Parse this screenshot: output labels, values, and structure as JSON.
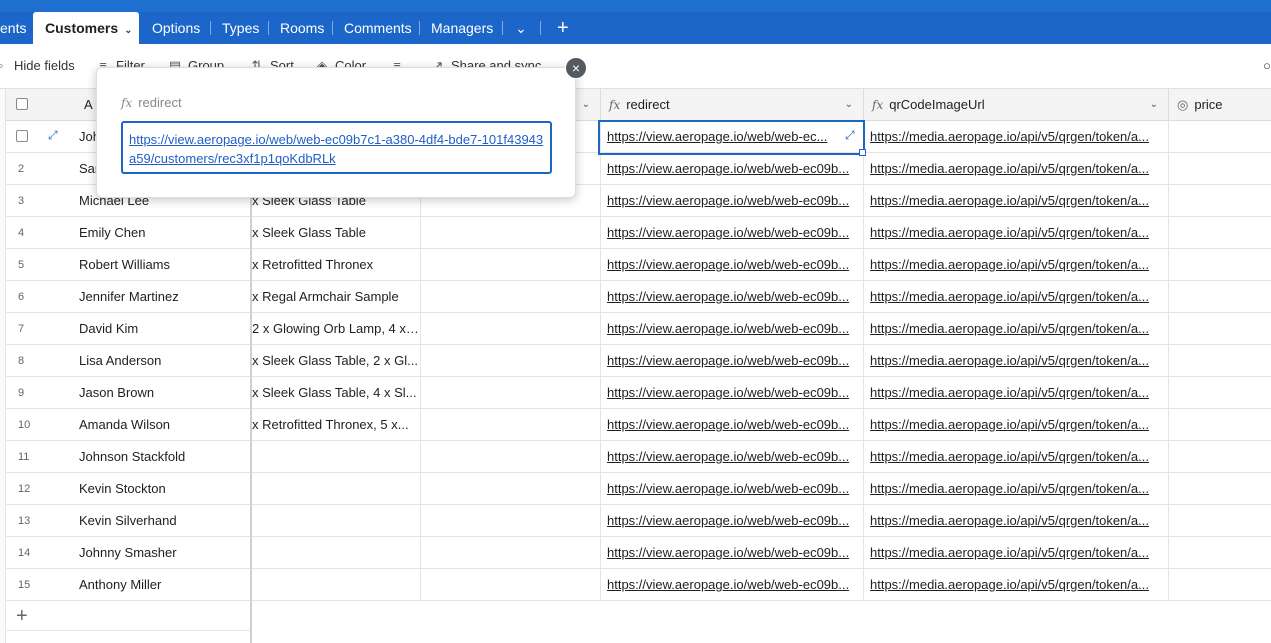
{
  "tabs": [
    {
      "label": "ents"
    },
    {
      "label": "Customers"
    },
    {
      "label": "Options"
    },
    {
      "label": "Types"
    },
    {
      "label": "Rooms"
    },
    {
      "label": "Comments"
    },
    {
      "label": "Managers"
    }
  ],
  "toolbar": {
    "hide_fields": "Hide fields",
    "filter": "Filter",
    "group": "Group",
    "sort": "Sort",
    "color": "Color",
    "share": "Share and sync"
  },
  "columns": {
    "name": "A",
    "redirect": "redirect",
    "qr": "qrCodeImageUrl",
    "price": "price"
  },
  "popup": {
    "label": "redirect",
    "url": "https://view.aeropage.io/web/web-ec09b7c1-a380-4df4-bde7-101f43943a59/customers/rec3xf1p1qoKdbRLk"
  },
  "rows": [
    {
      "num": "",
      "name": "Joh",
      "order": "",
      "redirect": "https://view.aeropage.io/web/web-ec...",
      "qr": "https://media.aeropage.io/api/v5/qrgen/token/a..."
    },
    {
      "num": "2",
      "name": "Sar",
      "order": "",
      "redirect": "https://view.aeropage.io/web/web-ec09b...",
      "qr": "https://media.aeropage.io/api/v5/qrgen/token/a..."
    },
    {
      "num": "3",
      "name": "Michael Lee",
      "order": "x Sleek Glass Table",
      "redirect": "https://view.aeropage.io/web/web-ec09b...",
      "qr": "https://media.aeropage.io/api/v5/qrgen/token/a..."
    },
    {
      "num": "4",
      "name": "Emily Chen",
      "order": "x Sleek Glass Table",
      "redirect": "https://view.aeropage.io/web/web-ec09b...",
      "qr": "https://media.aeropage.io/api/v5/qrgen/token/a..."
    },
    {
      "num": "5",
      "name": "Robert Williams",
      "order": "x Retrofitted Thronex",
      "redirect": "https://view.aeropage.io/web/web-ec09b...",
      "qr": "https://media.aeropage.io/api/v5/qrgen/token/a..."
    },
    {
      "num": "6",
      "name": "Jennifer Martinez",
      "order": "x Regal Armchair Sample",
      "redirect": "https://view.aeropage.io/web/web-ec09b...",
      "qr": "https://media.aeropage.io/api/v5/qrgen/token/a..."
    },
    {
      "num": "7",
      "name": "David Kim",
      "order": "2 x Glowing Orb Lamp, 4 x ...",
      "redirect": "https://view.aeropage.io/web/web-ec09b...",
      "qr": "https://media.aeropage.io/api/v5/qrgen/token/a..."
    },
    {
      "num": "8",
      "name": "Lisa Anderson",
      "order": "x Sleek Glass Table, 2 x Gl...",
      "redirect": "https://view.aeropage.io/web/web-ec09b...",
      "qr": "https://media.aeropage.io/api/v5/qrgen/token/a..."
    },
    {
      "num": "9",
      "name": "Jason Brown",
      "order": "x Sleek Glass Table, 4 x Sl...",
      "redirect": "https://view.aeropage.io/web/web-ec09b...",
      "qr": "https://media.aeropage.io/api/v5/qrgen/token/a..."
    },
    {
      "num": "10",
      "name": "Amanda Wilson",
      "order": "x Retrofitted Thronex, 5 x...",
      "redirect": "https://view.aeropage.io/web/web-ec09b...",
      "qr": "https://media.aeropage.io/api/v5/qrgen/token/a..."
    },
    {
      "num": "11",
      "name": "Johnson Stackfold",
      "order": "",
      "redirect": "https://view.aeropage.io/web/web-ec09b...",
      "qr": "https://media.aeropage.io/api/v5/qrgen/token/a..."
    },
    {
      "num": "12",
      "name": "Kevin Stockton",
      "order": "",
      "redirect": "https://view.aeropage.io/web/web-ec09b...",
      "qr": "https://media.aeropage.io/api/v5/qrgen/token/a..."
    },
    {
      "num": "13",
      "name": "Kevin Silverhand",
      "order": "",
      "redirect": "https://view.aeropage.io/web/web-ec09b...",
      "qr": "https://media.aeropage.io/api/v5/qrgen/token/a..."
    },
    {
      "num": "14",
      "name": "Johnny Smasher",
      "order": "",
      "redirect": "https://view.aeropage.io/web/web-ec09b...",
      "qr": "https://media.aeropage.io/api/v5/qrgen/token/a..."
    },
    {
      "num": "15",
      "name": "Anthony Miller",
      "order": "",
      "redirect": "https://view.aeropage.io/web/web-ec09b...",
      "qr": "https://media.aeropage.io/api/v5/qrgen/token/a..."
    }
  ]
}
